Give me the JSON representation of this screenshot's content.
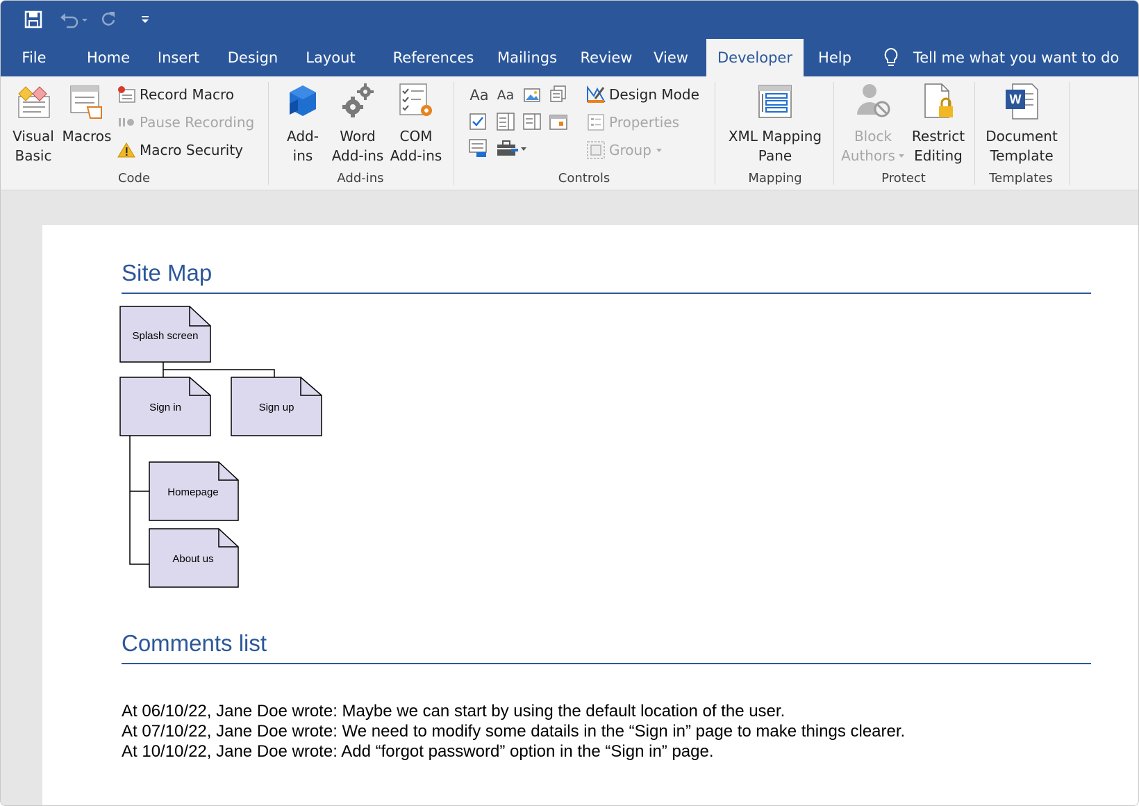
{
  "qat": {
    "save_icon": "save-icon",
    "undo_icon": "undo-icon",
    "redo_icon": "redo-icon",
    "customize_icon": "customize-qat-icon"
  },
  "menu": {
    "tabs": [
      "File",
      "Home",
      "Insert",
      "Design",
      "Layout",
      "References",
      "Mailings",
      "Review",
      "View",
      "Developer",
      "Help"
    ],
    "active_tab": "Developer",
    "tell_me": "Tell me what you want to do"
  },
  "ribbon": {
    "code": {
      "label": "Code",
      "visual_basic": [
        "Visual",
        "Basic"
      ],
      "macros": "Macros",
      "record_macro": "Record Macro",
      "pause_recording": "Pause Recording",
      "macro_security": "Macro Security"
    },
    "addins": {
      "label": "Add-ins",
      "addins_btn": [
        "Add-",
        "ins"
      ],
      "word_addins": [
        "Word",
        "Add-ins"
      ],
      "com_addins": [
        "COM",
        "Add-ins"
      ]
    },
    "controls": {
      "label": "Controls",
      "rich_text_glyph": "Aa",
      "plain_text_glyph": "Aa",
      "design_mode": "Design Mode",
      "properties": "Properties",
      "group": "Group"
    },
    "mapping": {
      "label": "Mapping",
      "xml_mapping": [
        "XML Mapping",
        "Pane"
      ]
    },
    "protect": {
      "label": "Protect",
      "block_authors": [
        "Block",
        "Authors"
      ],
      "restrict_editing": [
        "Restrict",
        "Editing"
      ]
    },
    "templates": {
      "label": "Templates",
      "document_template": [
        "Document",
        "Template"
      ]
    }
  },
  "document": {
    "site_map_heading": "Site Map",
    "comments_heading": "Comments list",
    "site_map_nodes": [
      "Splash screen",
      "Sign in",
      "Sign up",
      "Homepage",
      "About us"
    ],
    "comments": [
      "At 06/10/22, Jane Doe wrote: Maybe we can start by using the default location of the user.",
      "At 07/10/22, Jane Doe wrote: We need to modify some datails in the “Sign in” page to make things clearer.",
      "At 10/10/22, Jane Doe wrote: Add “forgot password” option in the “Sign in” page."
    ]
  },
  "colors": {
    "brand": "#2b579a",
    "node_fill": "#dcd9ee",
    "ribbon_bg": "#f3f3f3"
  }
}
